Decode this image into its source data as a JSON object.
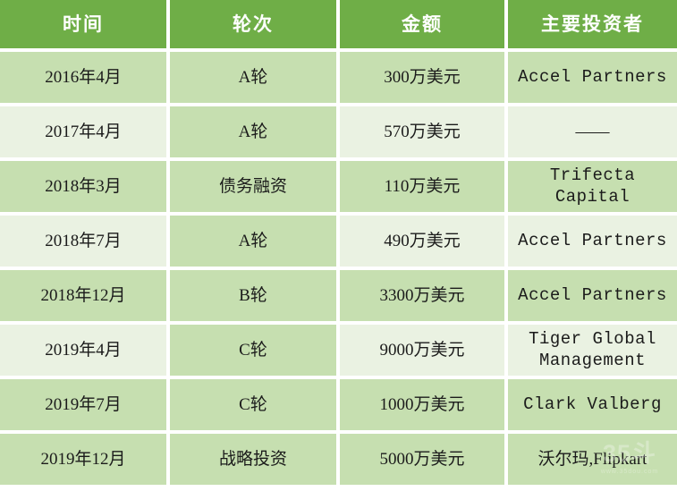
{
  "table": {
    "columns": [
      {
        "key": "date",
        "label": "时间"
      },
      {
        "key": "round",
        "label": "轮次"
      },
      {
        "key": "amount",
        "label": "金额"
      },
      {
        "key": "investor",
        "label": "主要投资者"
      }
    ],
    "rows": [
      {
        "date": "2016年4月",
        "round": "A轮",
        "amount": "300万美元",
        "investor": "Accel Partners"
      },
      {
        "date": "2017年4月",
        "round": "A轮",
        "amount": "570万美元",
        "investor": "——"
      },
      {
        "date": "2018年3月",
        "round": "债务融资",
        "amount": "110万美元",
        "investor": "Trifecta Capital"
      },
      {
        "date": "2018年7月",
        "round": "A轮",
        "amount": "490万美元",
        "investor": "Accel Partners"
      },
      {
        "date": "2018年12月",
        "round": "B轮",
        "amount": "3300万美元",
        "investor": "Accel Partners"
      },
      {
        "date": "2019年4月",
        "round": "C轮",
        "amount": "9000万美元",
        "investor": "Tiger Global Management"
      },
      {
        "date": "2019年7月",
        "round": "C轮",
        "amount": "1000万美元",
        "investor": "Clark Valberg"
      },
      {
        "date": "2019年12月",
        "round": "战略投资",
        "amount": "5000万美元",
        "investor": "沃尔玛,Flipkart"
      }
    ]
  },
  "watermark": {
    "main": "35斗",
    "sub": "www.35dou.com"
  },
  "colors": {
    "header_green": "#6FAE47",
    "row_mid_green": "#C6DFB0",
    "row_pale_green": "#EAF2E2",
    "gridline": "#FFFFFF",
    "header_text": "#FFFFFF",
    "body_text": "#1B1B1B"
  }
}
